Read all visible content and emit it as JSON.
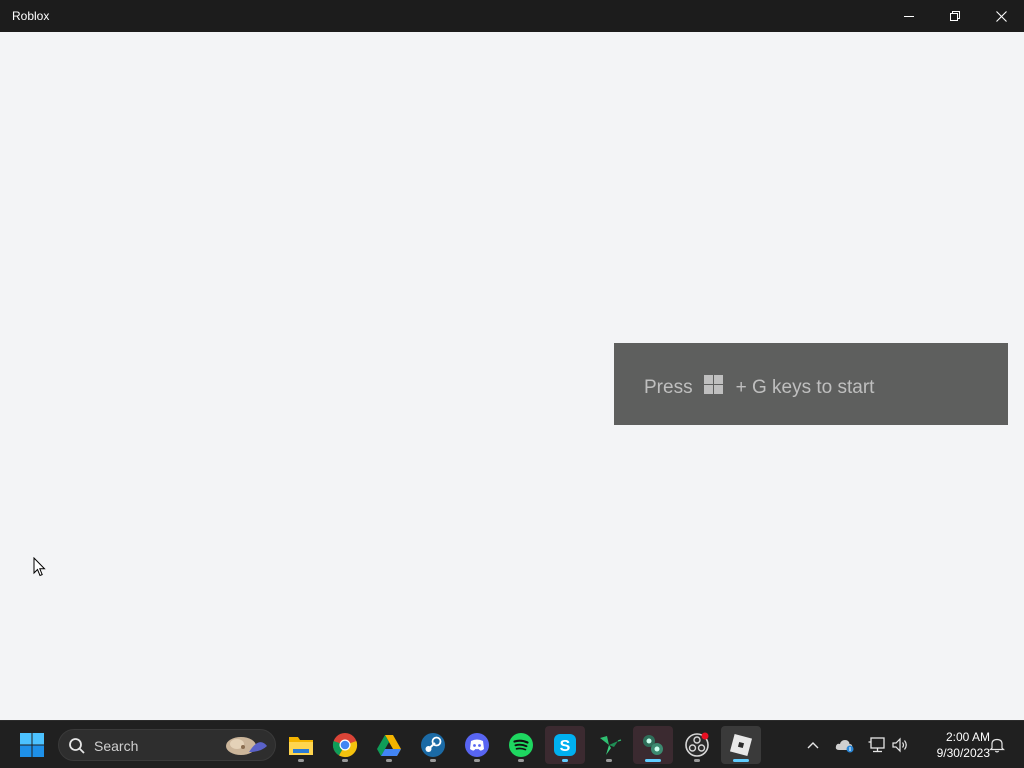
{
  "window": {
    "title": "Roblox"
  },
  "toast": {
    "prefix": "Press",
    "suffix": "+ G keys to start",
    "icon": "windows-logo-icon"
  },
  "taskbar": {
    "search_label": "Search",
    "apps": [
      {
        "name": "file-explorer-icon"
      },
      {
        "name": "chrome-icon"
      },
      {
        "name": "google-drive-icon"
      },
      {
        "name": "steam-icon"
      },
      {
        "name": "discord-icon"
      },
      {
        "name": "spotify-icon"
      },
      {
        "name": "skype-icon"
      },
      {
        "name": "hummingbird-icon"
      },
      {
        "name": "gaming-app-icon"
      },
      {
        "name": "obs-icon"
      },
      {
        "name": "roblox-icon"
      }
    ],
    "clock": {
      "time": "2:00 AM",
      "date": "9/30/2023"
    }
  },
  "colors": {
    "titlebar": "#1c1c1c",
    "client_bg": "#f3f4f6",
    "toast_bg": "#5e5f5e",
    "taskbar_bg": "#202020",
    "accent": "#60cdff"
  }
}
